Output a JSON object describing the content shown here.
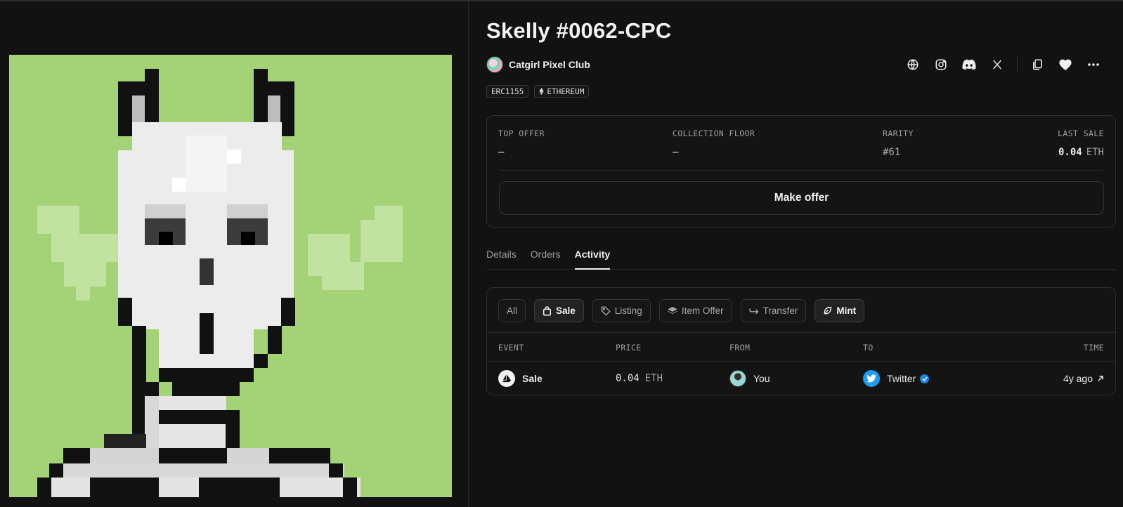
{
  "item": {
    "title": "Skelly #0062-CPC",
    "collection_name": "Catgirl Pixel Club",
    "tags": [
      "ERC1155",
      "ETHEREUM"
    ],
    "image_name": "skelly-pixel-art"
  },
  "social_icons": [
    "globe-icon",
    "instagram-icon",
    "discord-icon",
    "x-icon",
    "copy-icon",
    "heart-icon",
    "more-icon"
  ],
  "stats": {
    "top_offer": {
      "label": "TOP OFFER",
      "value": "–"
    },
    "collection_floor": {
      "label": "COLLECTION FLOOR",
      "value": "–"
    },
    "rarity": {
      "label": "RARITY",
      "value": "#61"
    },
    "last_sale": {
      "label": "LAST SALE",
      "value": "0.04",
      "unit": "ETH"
    }
  },
  "make_offer_label": "Make offer",
  "tabs": [
    {
      "label": "Details",
      "active": false
    },
    {
      "label": "Orders",
      "active": false
    },
    {
      "label": "Activity",
      "active": true
    }
  ],
  "activity": {
    "filters": [
      {
        "label": "All",
        "selected": false
      },
      {
        "label": "Sale",
        "selected": true
      },
      {
        "label": "Listing",
        "selected": false
      },
      {
        "label": "Item Offer",
        "selected": false
      },
      {
        "label": "Transfer",
        "selected": false
      },
      {
        "label": "Mint",
        "selected": true
      }
    ],
    "columns": [
      "EVENT",
      "PRICE",
      "FROM",
      "TO",
      "TIME"
    ],
    "rows": [
      {
        "event": "Sale",
        "price": "0.04",
        "unit": "ETH",
        "from": "You",
        "to": "Twitter",
        "time": "4y ago"
      }
    ]
  },
  "colors": {
    "background": "#121212",
    "art_background": "#a3d277",
    "verified_blue": "#2081e2",
    "twitter_blue": "#1d9bf0"
  }
}
